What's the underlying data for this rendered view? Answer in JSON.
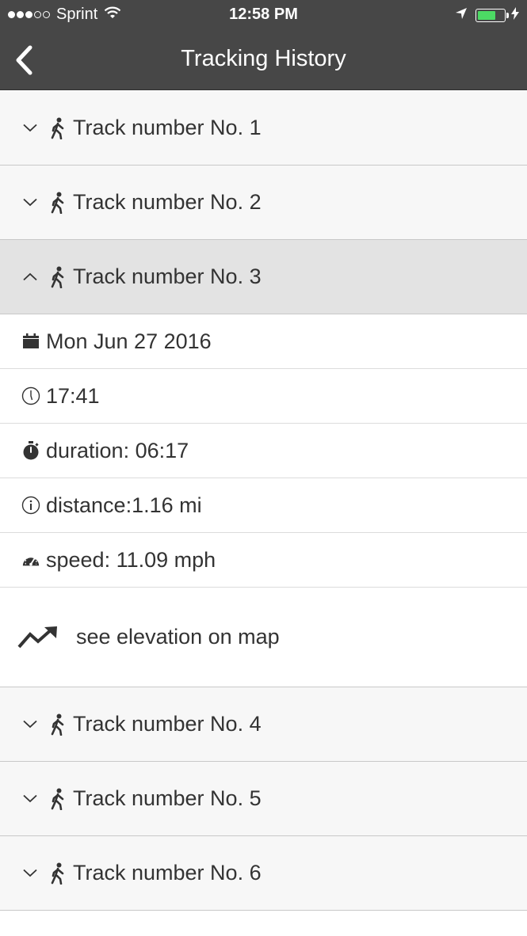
{
  "status_bar": {
    "carrier": "Sprint",
    "time": "12:58 PM",
    "battery_color": "#4cd964"
  },
  "nav": {
    "title": "Tracking History",
    "back_icon": "chevron-left-icon"
  },
  "tracks": [
    {
      "label": "Track number No. 1",
      "expanded": false
    },
    {
      "label": "Track number No. 2",
      "expanded": false
    },
    {
      "label": "Track number No. 3",
      "expanded": true
    },
    {
      "label": "Track number No. 4",
      "expanded": false
    },
    {
      "label": "Track number No. 5",
      "expanded": false
    },
    {
      "label": "Track number No. 6",
      "expanded": false
    }
  ],
  "details": {
    "date": "Mon Jun 27 2016",
    "time": "17:41",
    "duration": "duration: 06:17",
    "distance": "distance:1.16 mi",
    "speed": "speed: 11.09 mph",
    "elevation_link": "see elevation on map"
  },
  "colors": {
    "header_bg": "#474747",
    "row_bg": "#f7f7f7",
    "expanded_row_bg": "#e3e3e3",
    "text": "#333333"
  }
}
